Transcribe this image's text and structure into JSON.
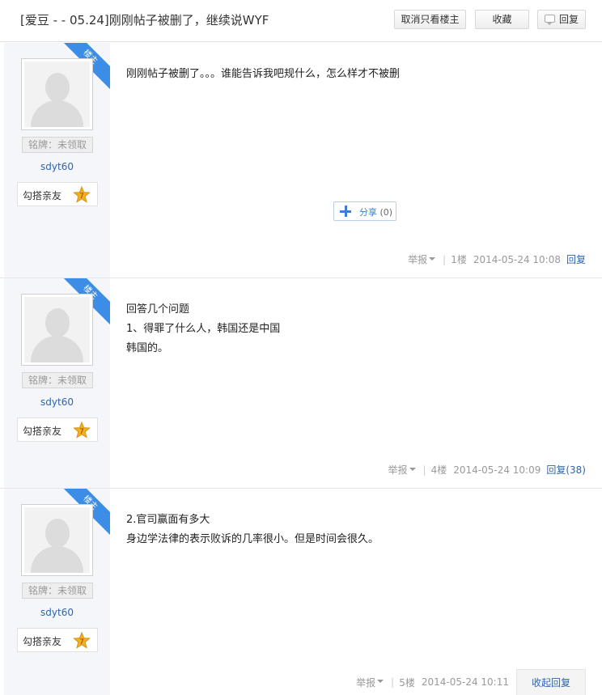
{
  "thread": {
    "title": "[爱豆 - - 05.24]刚刚帖子被删了，继续说WYF"
  },
  "toolbar": {
    "only_op_label": "取消只看楼主",
    "favorite_label": "收藏",
    "reply_label": "回复"
  },
  "posts": [
    {
      "badge": "楼主",
      "medal": "铭牌：未领取",
      "username": "sdyt60",
      "relation": "勾搭亲友",
      "level": "7",
      "lines": [
        "刚刚帖子被删了。。。谁能告诉我吧规什么，怎么样才不被删"
      ],
      "share": {
        "label": "分享",
        "count": "(0)"
      },
      "report": "举报",
      "floor": "1楼",
      "time": "2014-05-24 10:08",
      "reply": "回复"
    },
    {
      "badge": "楼主",
      "medal": "铭牌：未领取",
      "username": "sdyt60",
      "relation": "勾搭亲友",
      "level": "7",
      "lines": [
        "回答几个问题",
        "1、得罪了什么人，韩国还是中国",
        "韩国的。"
      ],
      "report": "举报",
      "floor": "4楼",
      "time": "2014-05-24 10:09",
      "reply": "回复(38)"
    },
    {
      "badge": "楼主",
      "medal": "铭牌：未领取",
      "username": "sdyt60",
      "relation": "勾搭亲友",
      "level": "7",
      "lines": [
        "2.官司赢面有多大",
        "身边学法律的表示败诉的几率很小。但是时间会很久。"
      ],
      "report": "举报",
      "floor": "5楼",
      "time": "2014-05-24 10:11",
      "reply": "收起回复"
    }
  ],
  "colors": {
    "link": "#2d64b3",
    "badge": "#3c8de6",
    "sidebar": "#f4f6f9",
    "level_star": "#f2b01e"
  }
}
